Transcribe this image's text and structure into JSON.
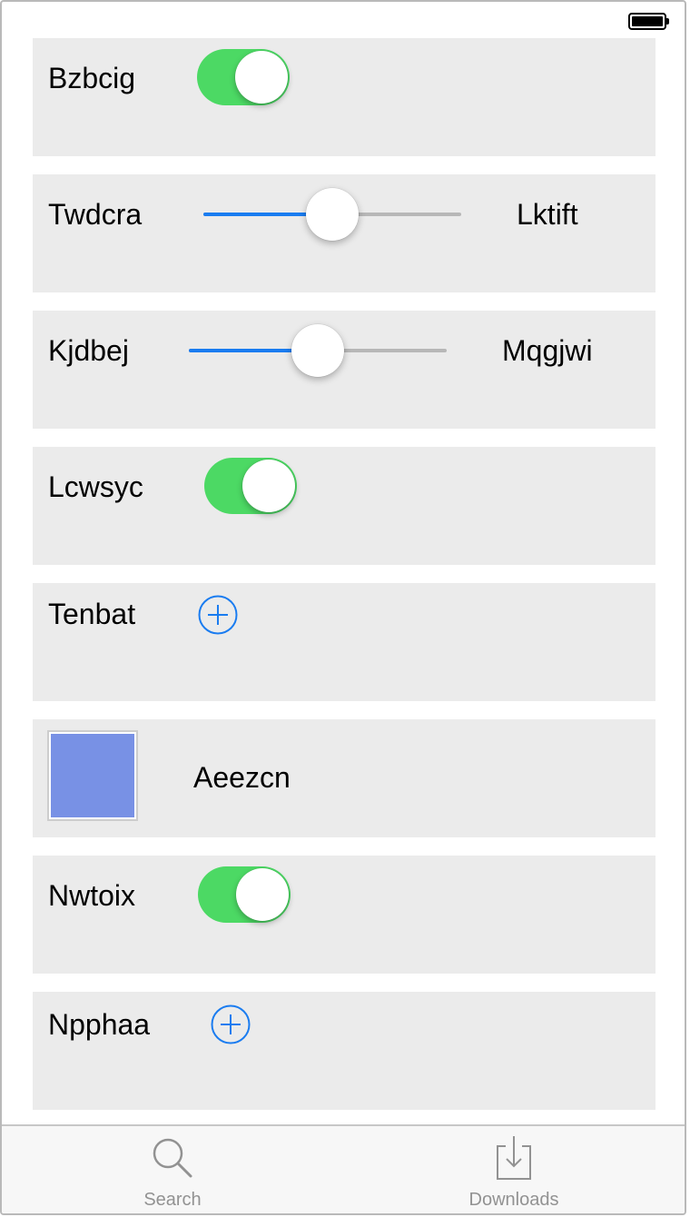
{
  "colors": {
    "toggle_on": "#4cd964",
    "accent": "#1a7cf0",
    "row_bg": "#ebebeb",
    "swatch": "#7891e5",
    "tab_inactive": "#929292"
  },
  "status_bar": {
    "battery_icon": "battery-full-icon"
  },
  "rows": [
    {
      "type": "toggle",
      "label": "Bzbcig",
      "on": true
    },
    {
      "type": "slider",
      "label": "Twdcra",
      "right_label": "Lktift",
      "value": 0.5
    },
    {
      "type": "slider",
      "label": "Kjdbej",
      "right_label": "Mqgjwi",
      "value": 0.5
    },
    {
      "type": "toggle",
      "label": "Lcwsyc",
      "on": true
    },
    {
      "type": "add",
      "label": "Tenbat",
      "icon": "add-circle-icon"
    },
    {
      "type": "swatch",
      "label": "Aeezcn",
      "color": "#7891e5"
    },
    {
      "type": "toggle",
      "label": "Nwtoix",
      "on": true
    },
    {
      "type": "add",
      "label": "Npphaa",
      "icon": "add-circle-icon"
    }
  ],
  "tabbar": {
    "tabs": [
      {
        "label": "Search",
        "icon": "search-icon"
      },
      {
        "label": "Downloads",
        "icon": "download-icon"
      }
    ]
  }
}
